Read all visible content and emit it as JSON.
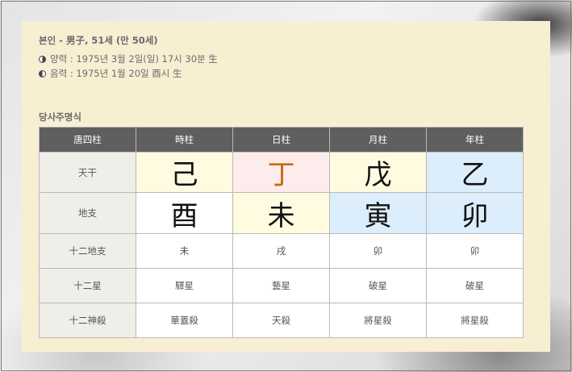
{
  "profile": {
    "title": "본인 - 男子, 51세 (만 50세)",
    "solar": "양력 : 1975년 3월 2일(일) 17시 30분 生",
    "lunar": "음력 : 1975년 1월 20일 酉시 生"
  },
  "section_title": "당사주명식",
  "table": {
    "headers": [
      "唐四柱",
      "時柱",
      "日柱",
      "月柱",
      "年柱"
    ],
    "stem_label": "天干",
    "stems": [
      "己",
      "丁",
      "戊",
      "乙"
    ],
    "branch_label": "地支",
    "branches": [
      "酉",
      "未",
      "寅",
      "卯"
    ],
    "rows": [
      {
        "label": "十二地支",
        "values": [
          "未",
          "戌",
          "卯",
          "卯"
        ]
      },
      {
        "label": "十二星",
        "values": [
          "驛星",
          "藝星",
          "破星",
          "破星"
        ]
      },
      {
        "label": "十二神殺",
        "values": [
          "華蓋殺",
          "天殺",
          "將星殺",
          "將星殺"
        ]
      }
    ]
  },
  "colors": {
    "panel_bg": "#f8efd3",
    "header_bg": "#5f5f5f",
    "yellow": "#fffbe0",
    "pink": "#fdecec",
    "blue": "#dcedfb",
    "orange_text": "#c96a12"
  },
  "icons": {
    "solar": "half-circle-right-filled-icon",
    "lunar": "half-circle-left-filled-icon"
  }
}
